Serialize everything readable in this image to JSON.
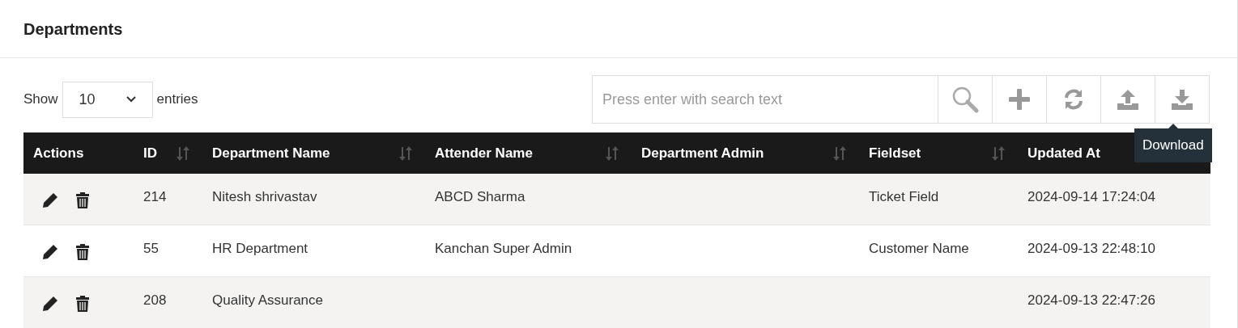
{
  "title": "Departments",
  "length_menu": {
    "prefix": "Show",
    "value": "10",
    "suffix": "entries"
  },
  "search": {
    "placeholder": "Press enter with search text"
  },
  "toolbar": [
    {
      "kind": "search"
    },
    {
      "kind": "add"
    },
    {
      "kind": "refresh"
    },
    {
      "kind": "upload"
    },
    {
      "kind": "download",
      "tooltip": "Download"
    }
  ],
  "table": {
    "columns": [
      {
        "label": "Actions",
        "sortable": false
      },
      {
        "label": "ID",
        "sortable": true
      },
      {
        "label": "Department Name",
        "sortable": true
      },
      {
        "label": "Attender Name",
        "sortable": true
      },
      {
        "label": "Department Admin",
        "sortable": true
      },
      {
        "label": "Fieldset",
        "sortable": true
      },
      {
        "label": "Updated At"
      }
    ],
    "rows": [
      {
        "id": "214",
        "department_name": "Nitesh shrivastav",
        "attender_name": "ABCD Sharma",
        "fieldset": "Ticket Field",
        "updated_at": "2024-09-14 17:24:04"
      },
      {
        "id": "55",
        "department_name": "HR Department",
        "attender_name": "Kanchan Super Admin",
        "fieldset": "Customer Name",
        "updated_at": "2024-09-13 22:48:10"
      },
      {
        "id": "208",
        "department_name": "Quality Assurance",
        "updated_at": "2024-09-13 22:47:26"
      }
    ]
  }
}
